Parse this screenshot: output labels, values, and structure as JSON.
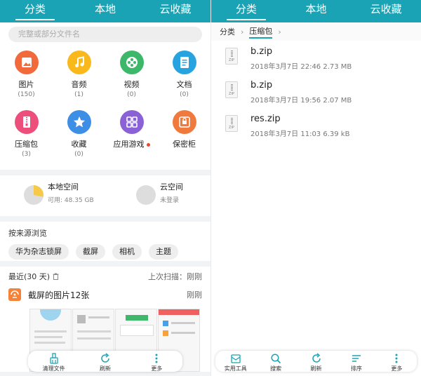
{
  "left": {
    "tabs": [
      "分类",
      "本地",
      "云收藏"
    ],
    "search_placeholder": "完整或部分文件名",
    "categories": [
      {
        "label": "图片",
        "count": "(150)",
        "color": "#f26a3c",
        "icon": "image-icon"
      },
      {
        "label": "音频",
        "count": "(1)",
        "color": "#f9b91d",
        "icon": "music-icon"
      },
      {
        "label": "视频",
        "count": "(0)",
        "color": "#3db86b",
        "icon": "video-reel-icon"
      },
      {
        "label": "文档",
        "count": "(0)",
        "color": "#27a4e0",
        "icon": "document-icon"
      },
      {
        "label": "压缩包",
        "count": "(3)",
        "color": "#ec4f7c",
        "icon": "zip-icon"
      },
      {
        "label": "收藏",
        "count": "(0)",
        "color": "#3d8fe6",
        "icon": "star-icon"
      },
      {
        "label": "应用游戏",
        "count": "",
        "color": "#8b62d6",
        "icon": "apps-icon"
      },
      {
        "label": "保密柜",
        "count": "",
        "color": "#f07a3e",
        "icon": "safe-icon"
      }
    ],
    "storage": {
      "local_title": "本地空间",
      "local_sub": "可用: 48.35 GB",
      "cloud_title": "云空间",
      "cloud_sub": "未登录"
    },
    "sources": {
      "header": "按来源浏览",
      "chips": [
        "华为杂志锁屏",
        "截屏",
        "相机",
        "主题"
      ]
    },
    "recent": {
      "title": "最近(30 天)",
      "last_scan": "上次扫描：刚刚",
      "group_title": "截屏的图片12张",
      "group_time": "刚刚"
    },
    "bottom_bar": [
      "清理文件",
      "刷新",
      "更多"
    ]
  },
  "right": {
    "tabs": [
      "分类",
      "本地",
      "云收藏"
    ],
    "breadcrumb": [
      "分类",
      "压缩包"
    ],
    "files": [
      {
        "name": "b.zip",
        "meta": "2018年3月7日 22:46 2.73 MB",
        "icon_label": "ZIP"
      },
      {
        "name": "b.zip",
        "meta": "2018年3月7日 19:56 2.07 MB",
        "icon_label": "ZIP"
      },
      {
        "name": "res.zip",
        "meta": "2018年3月7日 11:03 6.39 kB",
        "icon_label": "ZIP"
      }
    ],
    "bottom_bar": [
      "实用工具",
      "搜索",
      "刷新",
      "排序",
      "更多"
    ]
  },
  "colors": {
    "accent": "#1aa3b4"
  }
}
